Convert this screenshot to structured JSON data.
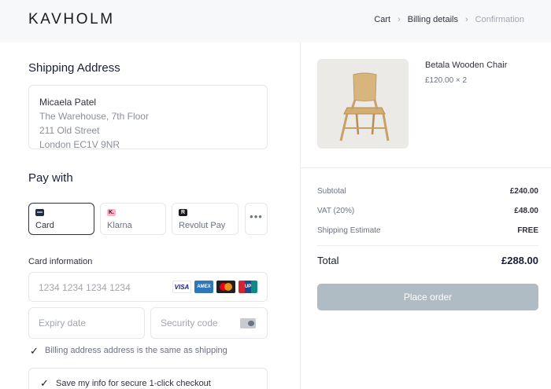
{
  "header": {
    "logo": "KAVHOLM",
    "breadcrumbs": [
      {
        "label": "Cart",
        "active": true
      },
      {
        "label": "Billing details",
        "active": true
      },
      {
        "label": "Confirmation",
        "active": false
      }
    ],
    "separator": "›"
  },
  "shipping": {
    "title": "Shipping Address",
    "name": "Micaela Patel",
    "lines": [
      "The Warehouse, 7th Floor",
      "211 Old Street",
      "London EC1V 9NR"
    ]
  },
  "payment": {
    "title": "Pay with",
    "methods": [
      {
        "label": "Card",
        "icon": "card-icon",
        "selected": true
      },
      {
        "label": "Klarna",
        "icon": "klarna-icon",
        "badge": "K.",
        "selected": false
      },
      {
        "label": "Revolut Pay",
        "icon": "revolut-icon",
        "badge": "R",
        "selected": false
      }
    ],
    "more": "•••"
  },
  "card": {
    "title": "Card information",
    "number_placeholder": "1234 1234 1234 1234",
    "expiry_placeholder": "Expiry date",
    "cvc_placeholder": "Security code",
    "brands": [
      {
        "name": "visa-icon",
        "text": "VISA"
      },
      {
        "name": "amex-icon",
        "text": "AMEX"
      },
      {
        "name": "mastercard-icon",
        "text": ""
      },
      {
        "name": "unionpay-icon",
        "text": "UP"
      }
    ]
  },
  "billing_same": {
    "label": "Billing address address is the same as shipping",
    "checked": true
  },
  "save_info": {
    "label": "Save my info for secure 1-click checkout",
    "checked": true
  },
  "order": {
    "product_name": "Betala Wooden Chair",
    "product_price": "£120.00 × 2",
    "subtotal_label": "Subtotal",
    "subtotal": "£240.00",
    "vat_label": "VAT (20%)",
    "vat": "£48.00",
    "shipping_label": "Shipping Estimate",
    "shipping": "FREE",
    "total_label": "Total",
    "total": "£288.00",
    "cta": "Place order"
  },
  "colors": {
    "accent_disabled": "#b0bcc3",
    "text": "#30313d",
    "muted": "#6b7280"
  }
}
